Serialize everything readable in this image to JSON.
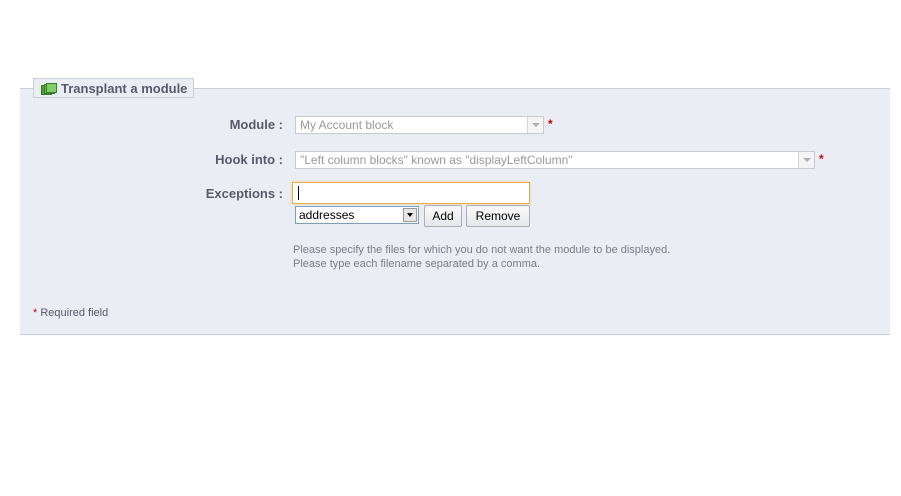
{
  "form": {
    "legend": "Transplant a module",
    "module": {
      "label": "Module :",
      "value": "My Account block",
      "required_mark": "*"
    },
    "hook": {
      "label": "Hook into :",
      "value": "\"Left column blocks\" known as \"displayLeftColumn\"",
      "required_mark": "*"
    },
    "exceptions": {
      "label": "Exceptions :",
      "input_value": "",
      "select_value": "addresses",
      "add_label": "Add",
      "remove_label": "Remove",
      "help_line1": "Please specify the files for which you do not want the module to be displayed.",
      "help_line2": "Please type each filename separated by a comma."
    },
    "required_note": {
      "star": "*",
      "text": "Required field"
    }
  }
}
